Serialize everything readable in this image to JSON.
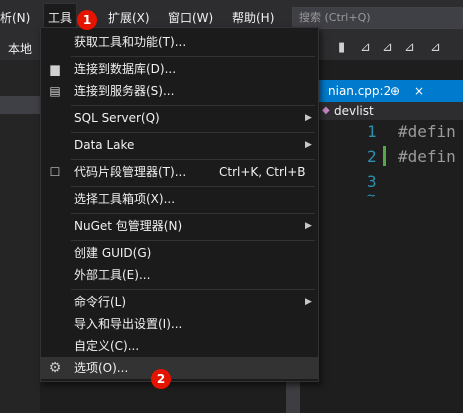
{
  "menubar": {
    "items": [
      "析(N)",
      "工具",
      "扩展(X)",
      "窗口(W)",
      "帮助(H)"
    ],
    "search_placeholder": "搜索 (Ctrl+Q)"
  },
  "toolbar": {
    "label": "本地"
  },
  "tab": {
    "title": "nian.cpp:2",
    "pin": "⊕",
    "close": "×"
  },
  "navbar": {
    "scope": "devlist"
  },
  "editor": {
    "line_numbers": [
      "1",
      "2",
      "3"
    ],
    "lines": [
      "#defin",
      "#defin"
    ],
    "eof_marker": "~"
  },
  "dropdown": {
    "items": [
      {
        "label": "获取工具和功能(T)...",
        "shortcut": "",
        "icon": "",
        "submenu": false
      },
      {
        "label": "连接到数据库(D)...",
        "shortcut": "",
        "icon": "database-icon",
        "submenu": false
      },
      {
        "label": "连接到服务器(S)...",
        "shortcut": "",
        "icon": "server-icon",
        "submenu": false
      },
      {
        "label": "SQL Server(Q)",
        "shortcut": "",
        "icon": "",
        "submenu": true
      },
      {
        "label": "Data Lake",
        "shortcut": "",
        "icon": "",
        "submenu": true
      },
      {
        "label": "代码片段管理器(T)...",
        "shortcut": "Ctrl+K, Ctrl+B",
        "icon": "snippet-icon",
        "submenu": false
      },
      {
        "label": "选择工具箱项(X)...",
        "shortcut": "",
        "icon": "",
        "submenu": false
      },
      {
        "label": "NuGet 包管理器(N)",
        "shortcut": "",
        "icon": "",
        "submenu": true
      },
      {
        "label": "创建 GUID(G)",
        "shortcut": "",
        "icon": "",
        "submenu": false
      },
      {
        "label": "外部工具(E)...",
        "shortcut": "",
        "icon": "",
        "submenu": false
      },
      {
        "label": "命令行(L)",
        "shortcut": "",
        "icon": "",
        "submenu": true
      },
      {
        "label": "导入和导出设置(I)...",
        "shortcut": "",
        "icon": "",
        "submenu": false
      },
      {
        "label": "自定义(C)...",
        "shortcut": "",
        "icon": "",
        "submenu": false
      },
      {
        "label": "选项(O)...",
        "shortcut": "",
        "icon": "gear-icon",
        "submenu": false
      }
    ]
  },
  "badges": [
    "1",
    "2"
  ],
  "colors": {
    "accent": "#007acc",
    "badge": "#e51400",
    "menu_bg": "#1b1b1c",
    "hover": "#333334"
  }
}
